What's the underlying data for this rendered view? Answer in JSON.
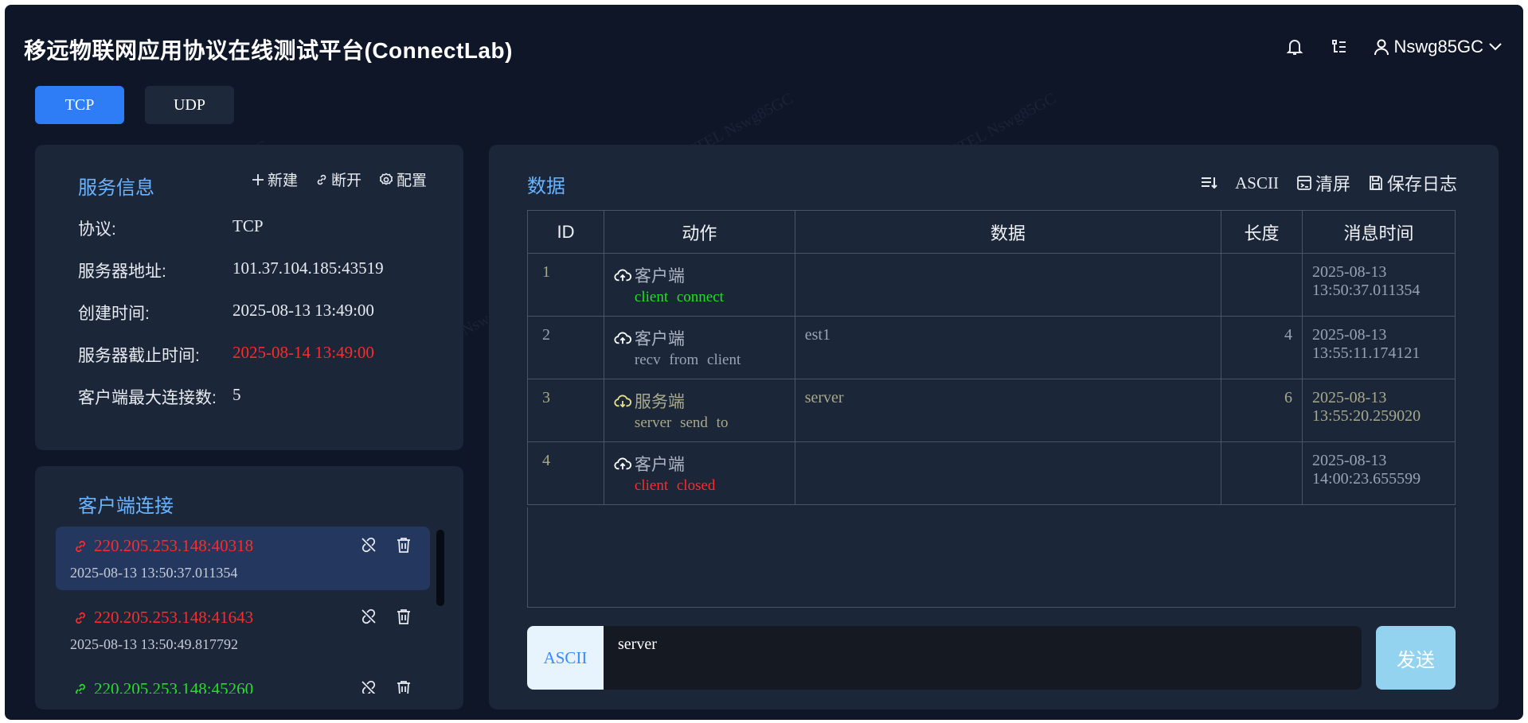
{
  "app": {
    "title": "移远物联网应用协议在线测试平台(ConnectLab)"
  },
  "header": {
    "username": "Nswg85GC"
  },
  "protocol_tabs": [
    {
      "label": "TCP",
      "active": true
    },
    {
      "label": "UDP",
      "active": false
    }
  ],
  "service_info": {
    "title": "服务信息",
    "actions": {
      "new": "新建",
      "disconnect": "断开",
      "config": "配置"
    },
    "rows": [
      {
        "label": "协议:",
        "value": "TCP"
      },
      {
        "label": "服务器地址:",
        "value": "101.37.104.185:43519"
      },
      {
        "label": "创建时间:",
        "value": "2025-08-13 13:49:00"
      },
      {
        "label": "服务器截止时间:",
        "value": "2025-08-14 13:49:00"
      },
      {
        "label": "客户端最大连接数:",
        "value": "5"
      }
    ]
  },
  "clients": {
    "title": "客户端连接",
    "items": [
      {
        "ip": "220.205.253.148:40318",
        "time": "2025-08-13 13:50:37.011354",
        "status_color": "#ff2a2a"
      },
      {
        "ip": "220.205.253.148:41643",
        "time": "2025-08-13 13:50:49.817792",
        "status_color": "#ff2a2a"
      },
      {
        "ip": "220.205.253.148:45260",
        "time": "",
        "status_color": "#21e021"
      }
    ]
  },
  "data_panel": {
    "title": "数据",
    "tools": {
      "mode": "ASCII",
      "clear": "清屏",
      "save_log": "保存日志"
    },
    "columns": [
      "ID",
      "动作",
      "数据",
      "长度",
      "消息时间"
    ],
    "rows": [
      {
        "id": "1",
        "actor": "客户端",
        "action": "client  connect",
        "data": "",
        "length": "",
        "time_date": "2025-08-13",
        "time_clock": "13:50:37.011354"
      },
      {
        "id": "2",
        "actor": "客户端",
        "action": "recv  from  client",
        "data": "est1",
        "length": "4",
        "time_date": "2025-08-13",
        "time_clock": "13:55:11.174121"
      },
      {
        "id": "3",
        "actor": "服务端",
        "action": "server  send  to",
        "data": "server",
        "length": "6",
        "time_date": "2025-08-13",
        "time_clock": "13:55:20.259020"
      },
      {
        "id": "4",
        "actor": "客户端",
        "action": "client  closed",
        "data": "",
        "length": "",
        "time_date": "2025-08-13",
        "time_clock": "14:00:23.655599"
      }
    ],
    "send": {
      "mode": "ASCII",
      "input_value": "server",
      "button": "发送"
    }
  },
  "watermark": "QUECTEL Nswg85GC",
  "colors": {
    "accent": "#2f7df6",
    "title_blue": "#69b3ff",
    "error_red": "#ff2a2a",
    "ok_green": "#21e021"
  }
}
